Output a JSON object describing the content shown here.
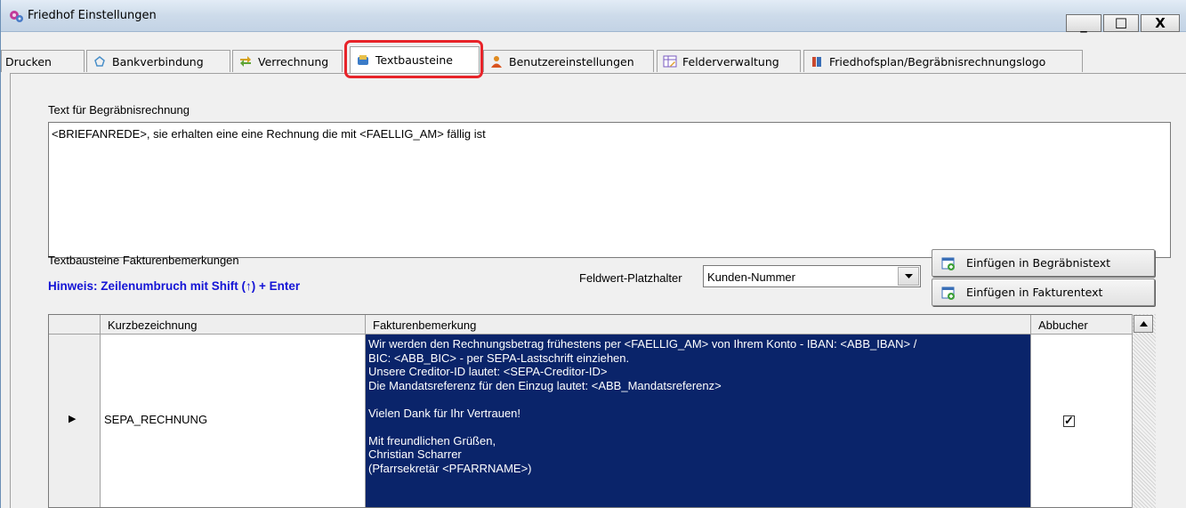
{
  "window": {
    "title": "Friedhof Einstellungen",
    "minimize": "_",
    "maximize": "☐",
    "close": "X"
  },
  "tabs": [
    {
      "label": "Drucken",
      "icon": null
    },
    {
      "label": "Bankverbindung",
      "icon": "bank-icon"
    },
    {
      "label": "Verrechnung",
      "icon": "arrows-icon"
    },
    {
      "label": "Textbausteine",
      "icon": "textblocks-icon",
      "active": true
    },
    {
      "label": "Benutzereinstellungen",
      "icon": "user-icon"
    },
    {
      "label": "Felderverwaltung",
      "icon": "fields-icon"
    },
    {
      "label": "Friedhofsplan/Begräbnisrechnungslogo",
      "icon": "plan-icon"
    }
  ],
  "main": {
    "burial_text_label": "Text für Begräbnisrechnung",
    "burial_text_value": "<BRIEFANREDE>, sie erhalten eine eine Rechnung die mit <FAELLIG_AM> fällig ist",
    "remarks_label": "Textbausteine Fakturenbemerkungen",
    "hint": "Hinweis: Zeilenumbruch mit Shift (↑) + Enter",
    "placeholder_label": "Feldwert-Platzhalter",
    "placeholder_value": "Kunden-Nummer",
    "insert_burial_button": "Einfügen in Begräbnistext",
    "insert_invoice_button": "Einfügen in Fakturentext"
  },
  "grid": {
    "columns": [
      "Kurzbezeichnung",
      "Fakturenbemerkung",
      "Abbucher"
    ],
    "rows": [
      {
        "short_name": "SEPA_RECHNUNG",
        "remark_lines": [
          "Wir werden den Rechnungsbetrag frühestens per <FAELLIG_AM> von Ihrem Konto  - IBAN: <ABB_IBAN> /",
          "BIC: <ABB_BIC> - per SEPA-Lastschrift einziehen.",
          "Unsere Creditor-ID lautet: <SEPA-Creditor-ID>",
          "Die Mandatsreferenz für den Einzug lautet: <ABB_Mandatsreferenz>",
          "",
          "Vielen Dank für Ihr Vertrauen!",
          "",
          "Mit freundlichen Grüßen,",
          "Christian Scharrer",
          "(Pfarrsekretär <PFARRNAME>)"
        ],
        "debit": true,
        "row_marker": "▶",
        "check_mark": "✓"
      }
    ]
  },
  "colors": {
    "selection": "#0a246a",
    "hint": "#1414d6",
    "highlight": "#e8242a"
  }
}
